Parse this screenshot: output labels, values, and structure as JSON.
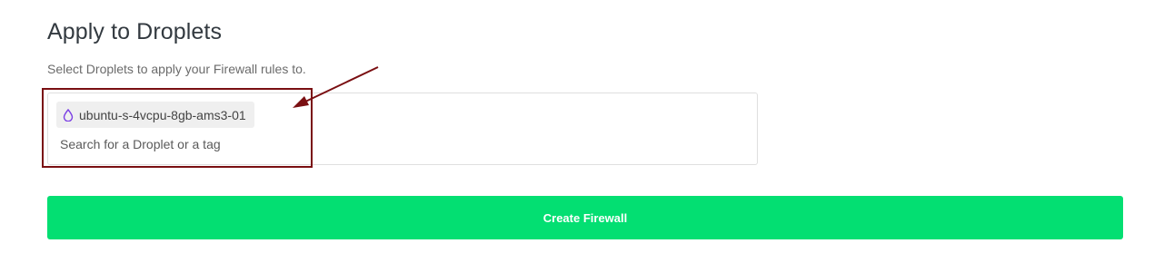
{
  "section": {
    "title": "Apply to Droplets",
    "description": "Select Droplets to apply your Firewall rules to."
  },
  "droplet_selector": {
    "selected_chip": {
      "label": "ubuntu-s-4vcpu-8gb-ams3-01",
      "icon": "droplet-icon",
      "icon_color": "#7b3fe4"
    },
    "search_placeholder": "Search for a Droplet or a tag",
    "search_value": ""
  },
  "actions": {
    "create_label": "Create Firewall",
    "create_color": "#03df72"
  },
  "annotation": {
    "color": "#7a0f12"
  }
}
